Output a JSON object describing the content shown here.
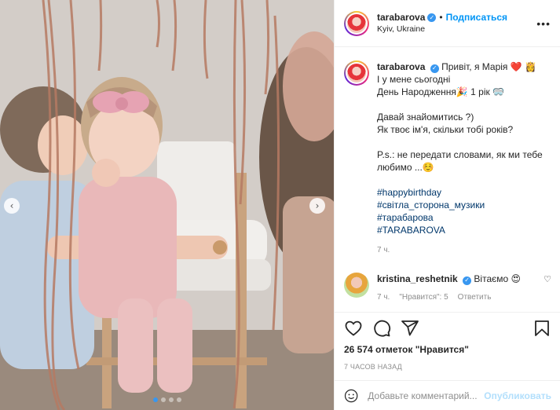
{
  "post": {
    "image_description_alt": "",
    "carousel_prev_icon": "chevron-left-icon",
    "carousel_next_icon": "chevron-right-icon",
    "carousel_count": 4,
    "carousel_active": 0
  },
  "header": {
    "username": "tarabarova",
    "verified": true,
    "separator": "•",
    "follow_label": "Подписаться",
    "location": "Kyiv, Ukraine",
    "more_label": "•••"
  },
  "caption": {
    "username": "tarabarova",
    "lines": [
      "Привіт, я Марія ❤️ 👸",
      "І у мене сьогодні",
      "День Народження🎉 1 рік 🥽"
    ],
    "lines2": [
      "Давай знайомитись ?)",
      "Як твоє ім'я, скільки тобі років?"
    ],
    "lines3": [
      "P.s.: не передати словами, як ми тебе",
      "любимо ...☺️"
    ],
    "hashtags": [
      "#happybirthday",
      "#світла_сторона_музики",
      "#тарабарова",
      "#TARABAROVA"
    ],
    "time": "7 ч."
  },
  "comment": {
    "username": "kristina_reshetnik",
    "verified": true,
    "text": "Вітаємо 😍",
    "time": "7 ч.",
    "likes_label": "\"Нравится\": 5",
    "reply_label": "Ответить"
  },
  "actions": {
    "likes": "26 574 отметок \"Нравится\"",
    "time_ago": "7 часов назад"
  },
  "add_comment": {
    "placeholder": "Добавьте комментарий...",
    "publish_label": "Опубликовать"
  },
  "colors": {
    "accent": "#0095f6",
    "publish_disabled": "#b2dffc",
    "hashtag": "#00376b",
    "meta": "#8e8e8e",
    "carousel_active_dot": "#3897f0"
  }
}
